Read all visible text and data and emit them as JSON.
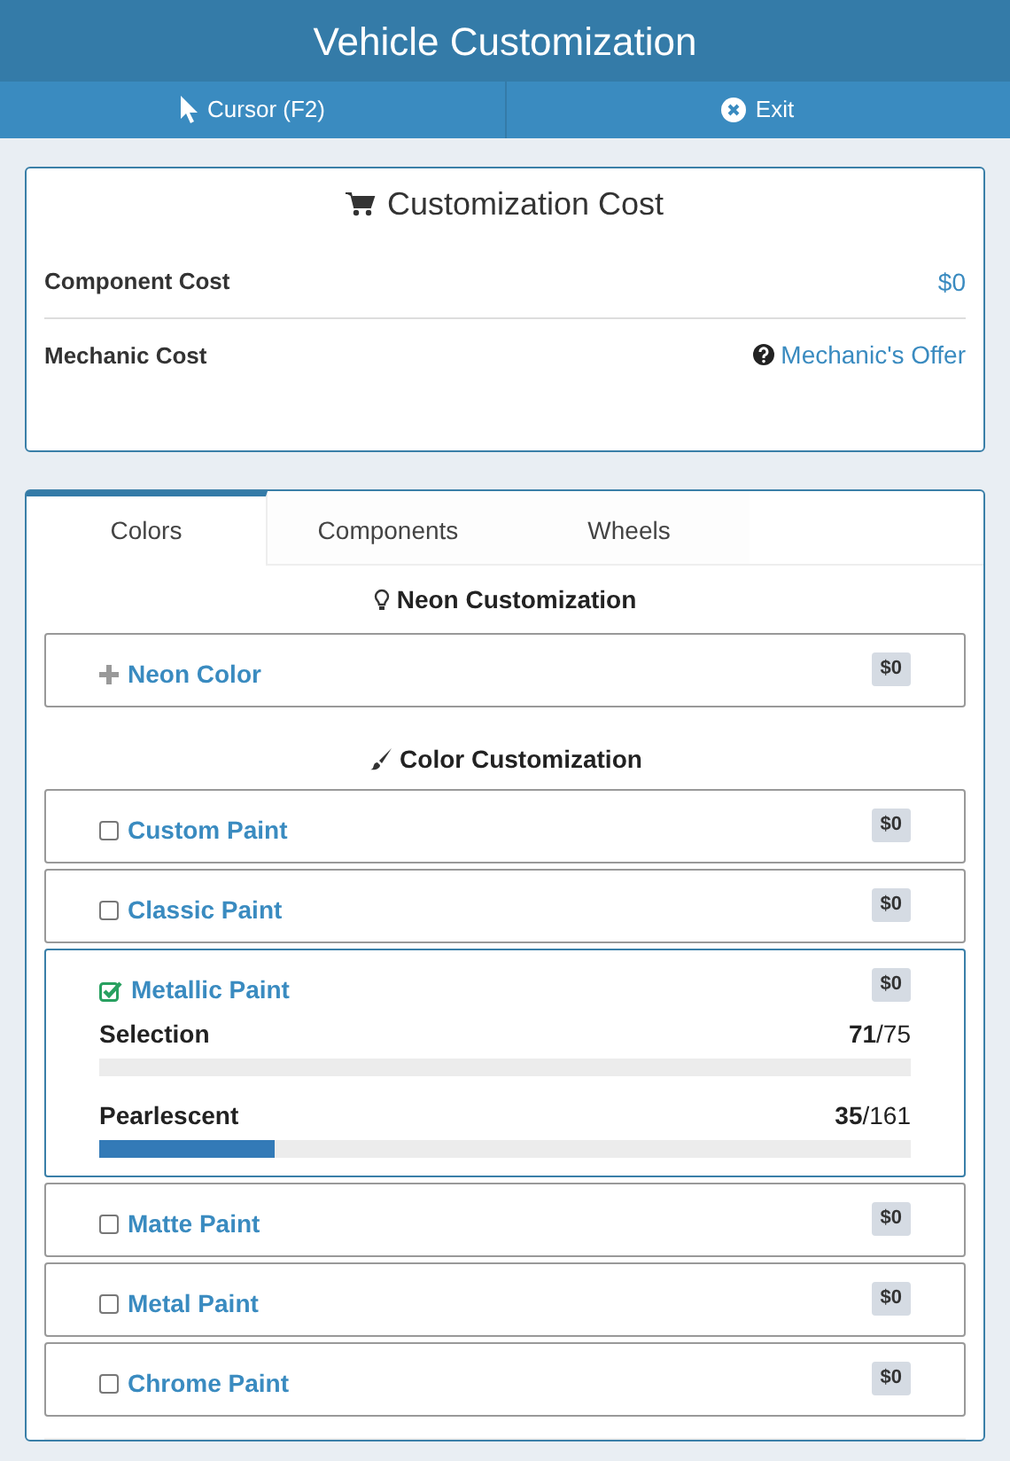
{
  "window": {
    "title": "Vehicle Customization"
  },
  "toolbar": [
    {
      "kind": "cursor",
      "label": "Cursor (F2)"
    },
    {
      "kind": "exit",
      "label": "Exit"
    }
  ],
  "cost_card": {
    "title": "Customization Cost",
    "rows": [
      {
        "label": "Component Cost",
        "value": "$0",
        "kind": "plain"
      },
      {
        "label": "Mechanic Cost",
        "value": "Mechanic's Offer",
        "kind": "help"
      }
    ]
  },
  "tabs": [
    {
      "label": "Colors",
      "selected": true
    },
    {
      "label": "Components",
      "selected": false
    },
    {
      "label": "Wheels",
      "selected": false
    }
  ],
  "sections": [
    {
      "kind": "neon",
      "title": "Neon Customization",
      "items": [
        {
          "kind": "add",
          "label": "Neon Color",
          "price": "$0"
        }
      ]
    },
    {
      "kind": "paint",
      "title": "Color Customization",
      "items": [
        {
          "kind": "checkbox",
          "label": "Custom Paint",
          "price": "$0",
          "checked": false
        },
        {
          "kind": "checkbox",
          "label": "Classic Paint",
          "price": "$0",
          "checked": false
        },
        {
          "kind": "checkbox",
          "label": "Metallic Paint",
          "price": "$0",
          "checked": true,
          "sliders": [
            {
              "label": "Selection",
              "current": "71",
              "total": "/75"
            },
            {
              "label": "Pearlescent",
              "current": "35",
              "total": "/161",
              "level": 0.217
            }
          ]
        },
        {
          "kind": "checkbox",
          "label": "Matte Paint",
          "price": "$0",
          "checked": false
        },
        {
          "kind": "checkbox",
          "label": "Metal Paint",
          "price": "$0",
          "checked": false
        },
        {
          "kind": "checkbox",
          "label": "Chrome Paint",
          "price": "$0",
          "checked": false
        }
      ]
    }
  ]
}
